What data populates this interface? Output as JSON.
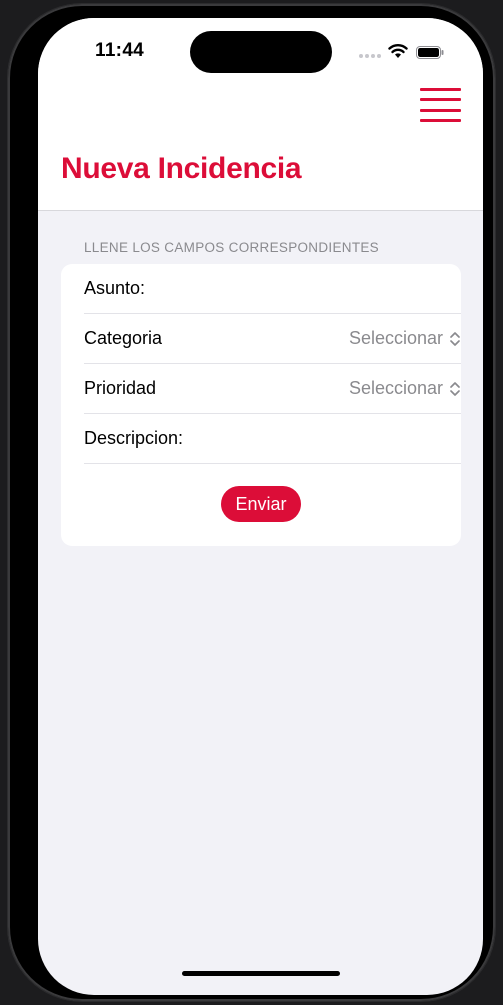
{
  "status_bar": {
    "time": "11:44",
    "icons": [
      "signal-icon",
      "wifi-icon",
      "battery-icon"
    ]
  },
  "header": {
    "menu_icon": "hamburger-menu-icon",
    "title": "Nueva Incidencia"
  },
  "form": {
    "section_header": "LLENE LOS CAMPOS CORRESPONDIENTES",
    "fields": [
      {
        "label": "Asunto:",
        "value": ""
      },
      {
        "label": "Categoria",
        "value": "Seleccionar"
      },
      {
        "label": "Prioridad",
        "value": "Seleccionar"
      },
      {
        "label": "Descripcion:",
        "value": ""
      }
    ],
    "submit_label": "Enviar"
  },
  "colors": {
    "accent": "#dc0d38",
    "background": "#f2f2f7",
    "secondary_text": "#8a8a8e"
  }
}
